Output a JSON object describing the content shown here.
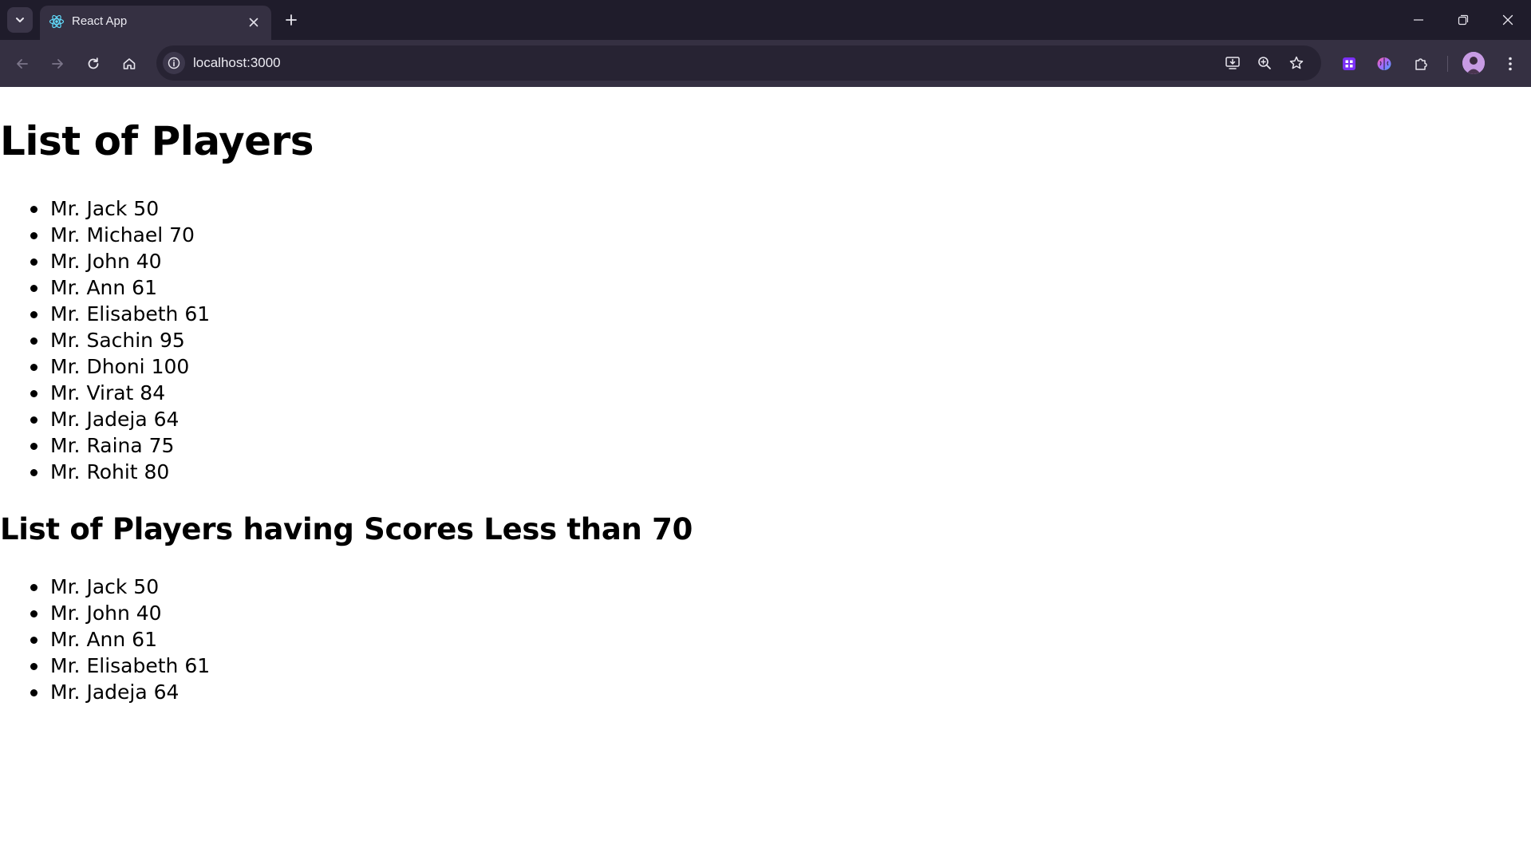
{
  "browser": {
    "tab_title": "React App",
    "url": "localhost:3000",
    "colors": {
      "tabstrip_bg": "#1f1c2b",
      "toolbar_bg": "#353042",
      "omnibox_bg": "#272333"
    }
  },
  "page": {
    "heading": "List of Players",
    "players": [
      {
        "label": "Mr. Jack 50"
      },
      {
        "label": "Mr. Michael 70"
      },
      {
        "label": "Mr. John 40"
      },
      {
        "label": "Mr. Ann 61"
      },
      {
        "label": "Mr. Elisabeth 61"
      },
      {
        "label": "Mr. Sachin 95"
      },
      {
        "label": "Mr. Dhoni 100"
      },
      {
        "label": "Mr. Virat 84"
      },
      {
        "label": "Mr. Jadeja 64"
      },
      {
        "label": "Mr. Raina 75"
      },
      {
        "label": "Mr. Rohit 80"
      }
    ],
    "subheading": "List of Players having Scores Less than 70",
    "players_under_70": [
      {
        "label": "Mr. Jack 50"
      },
      {
        "label": "Mr. John 40"
      },
      {
        "label": "Mr. Ann 61"
      },
      {
        "label": "Mr. Elisabeth 61"
      },
      {
        "label": "Mr. Jadeja 64"
      }
    ]
  }
}
